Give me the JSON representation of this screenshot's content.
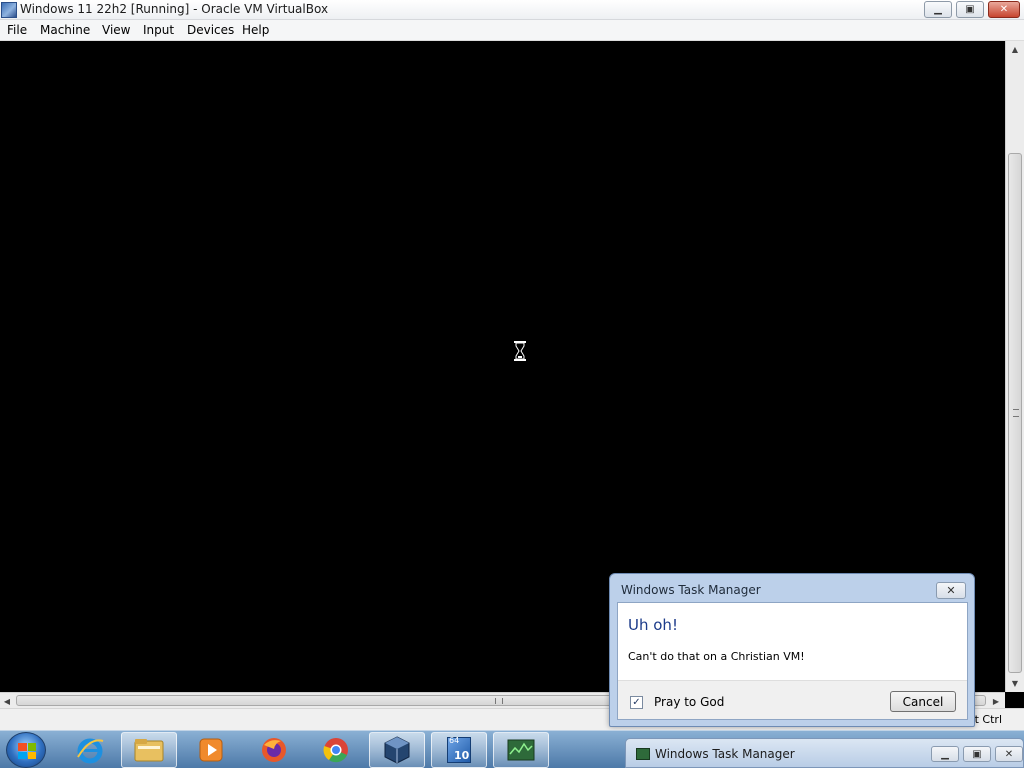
{
  "window": {
    "title": "Windows 11 22h2 [Running] - Oracle VM VirtualBox",
    "minimize_glyph": "▁",
    "maximize_glyph": "▣",
    "close_glyph": "✕"
  },
  "menu": {
    "items": [
      {
        "label": "File"
      },
      {
        "label": "Machine"
      },
      {
        "label": "View"
      },
      {
        "label": "Input"
      },
      {
        "label": "Devices"
      },
      {
        "label": "Help"
      }
    ]
  },
  "statusbar": {
    "host_key": "nt Ctrl"
  },
  "dialog": {
    "title": "Windows Task Manager",
    "heading": "Uh oh!",
    "message": "Can't do that on a Christian VM!",
    "checkbox_label": "Pray to God",
    "checkbox_checked": true,
    "checkbox_glyph": "✓",
    "cancel_label": "Cancel",
    "close_glyph": "✕"
  },
  "taskbar": {
    "icons": [
      {
        "name": "internet-explorer-icon",
        "active": false,
        "color": "#1e90e0"
      },
      {
        "name": "file-explorer-icon",
        "active": true,
        "color": "#e8c060"
      },
      {
        "name": "media-player-icon",
        "active": false,
        "color": "#f08a2c"
      },
      {
        "name": "firefox-icon",
        "active": false,
        "color": "#e8582a"
      },
      {
        "name": "chrome-icon",
        "active": false,
        "color": "#3aa757"
      },
      {
        "name": "virtualbox-icon",
        "active": true,
        "color": "#24456f"
      },
      {
        "name": "windows-10-iso-icon",
        "active": true,
        "color": "#3a78c8",
        "badge_top": "64",
        "badge_bottom": "10"
      },
      {
        "name": "task-manager-icon",
        "active": true,
        "color": "#2e6a3a"
      }
    ],
    "minimized_window": {
      "title": "Windows Task Manager"
    }
  },
  "colors": {
    "vm_screen": "#000000",
    "dialog_heading": "#1c3b8a",
    "dialog_frame": "#bcd0ea",
    "taskbar": "#4d79a8"
  }
}
